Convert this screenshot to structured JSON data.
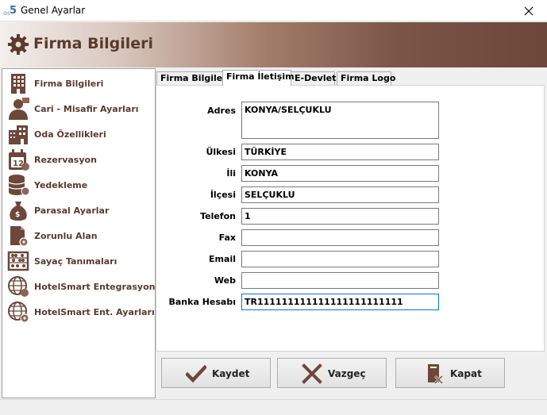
{
  "window": {
    "title": "Genel Ayarlar",
    "icon_text": "os"
  },
  "header": {
    "title": "Firma Bilgileri"
  },
  "sidebar": {
    "items": [
      {
        "label": "Firma Bilgileri",
        "icon": "building-icon"
      },
      {
        "label": "Cari - Misafir Ayarları",
        "icon": "guest-user-icon"
      },
      {
        "label": "Oda Özellikleri",
        "icon": "hotel-room-icon"
      },
      {
        "label": "Rezervasyon",
        "icon": "calendar-icon"
      },
      {
        "label": "Yedekleme",
        "icon": "database-backup-icon"
      },
      {
        "label": "Parasal Ayarlar",
        "icon": "money-bag-icon"
      },
      {
        "label": "Zorunlu Alan",
        "icon": "document-settings-icon"
      },
      {
        "label": "Sayaç Tanımaları",
        "icon": "abacus-icon"
      },
      {
        "label": "HotelSmart Entegrasyonu",
        "icon": "globe-integration-icon"
      },
      {
        "label": "HotelSmart Ent. Ayarları",
        "icon": "globe-settings-icon"
      }
    ]
  },
  "tabs": [
    {
      "label": "Firma Bilgileri"
    },
    {
      "label": "Firma İletişim"
    },
    {
      "label": "E-Devlet"
    },
    {
      "label": "Firma Logo"
    }
  ],
  "form": {
    "adres": {
      "label": "Adres",
      "value": "KONYA/SELÇUKLU"
    },
    "ulkesi": {
      "label": "Ülkesi",
      "value": "TÜRKİYE"
    },
    "ili": {
      "label": "İli",
      "value": "KONYA"
    },
    "ilcesi": {
      "label": "İlçesi",
      "value": "SELÇUKLU"
    },
    "telefon": {
      "label": "Telefon",
      "value": "1"
    },
    "fax": {
      "label": "Fax",
      "value": ""
    },
    "email": {
      "label": "Email",
      "value": ""
    },
    "web": {
      "label": "Web",
      "value": ""
    },
    "banka": {
      "label": "Banka Hesabı",
      "value": "TR111111111111111111111111"
    }
  },
  "buttons": {
    "save": "Kaydet",
    "cancel": "Vazgeç",
    "close": "Kapat"
  },
  "colors": {
    "accent_brown": "#5a3a2e",
    "banner_dark": "#6c473a",
    "focus_blue": "#0078d7"
  }
}
